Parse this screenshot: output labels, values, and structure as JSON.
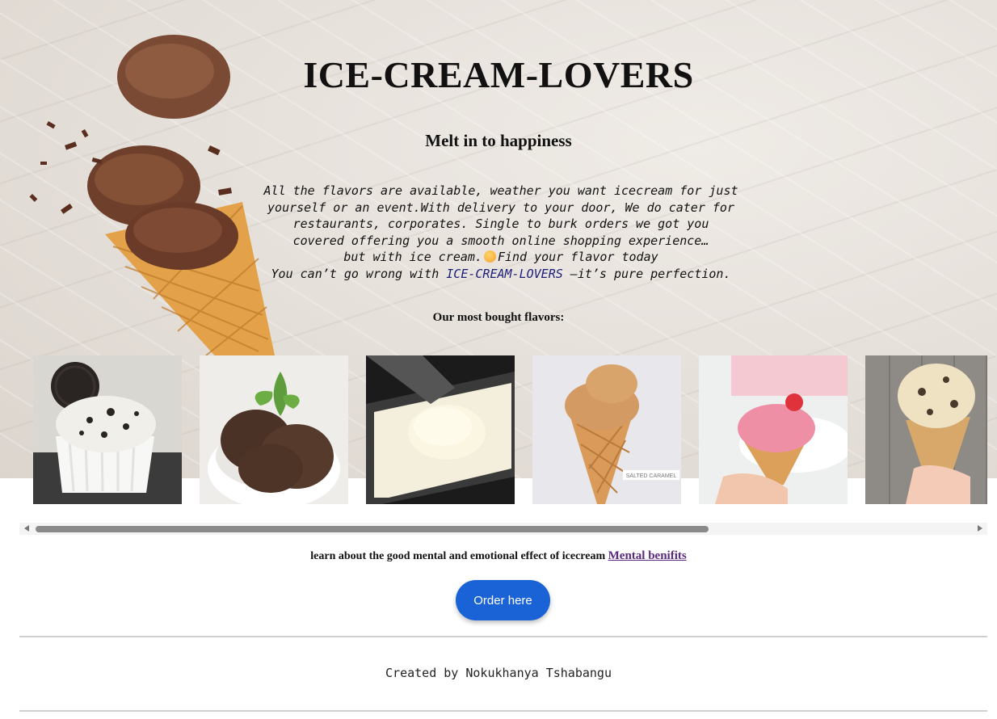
{
  "header": {
    "title": "ICE-CREAM-LOVERS",
    "subtitle": "Melt in to happiness"
  },
  "intro": {
    "line1": "All the flavors are available, weather you want icecream for just",
    "line2": "yourself or an event.With delivery to your door, We do cater for",
    "line3": "restaurants, corporates. Single to burk orders we got you",
    "line4": "covered offering you a smooth online shopping experience…",
    "line5_before": "but with ice cream.",
    "line5_after": "Find your flavor today",
    "line6_before": "You can’t go wrong with ",
    "line6_brand": "ICE-CREAM-LOVERS",
    "line6_after": " —it’s pure perfection."
  },
  "flavors": {
    "heading": "Our most bought flavors:",
    "images": [
      "cookies-and-cream",
      "chocolate-chip",
      "vanilla",
      "salted-caramel",
      "strawberry",
      "cookie-dough"
    ],
    "caramel_tag": "SALTED CARAMEL"
  },
  "mental": {
    "text": "learn about the good mental and emotional effect of icecream",
    "link": "Mental benifits"
  },
  "order": {
    "label": "Order here"
  },
  "footer": {
    "text": "Created by Nokukhanya Tshabangu"
  },
  "colors": {
    "button": "#1a63d6",
    "brand_text": "#1b1f7a",
    "link": "#5a2a82"
  }
}
